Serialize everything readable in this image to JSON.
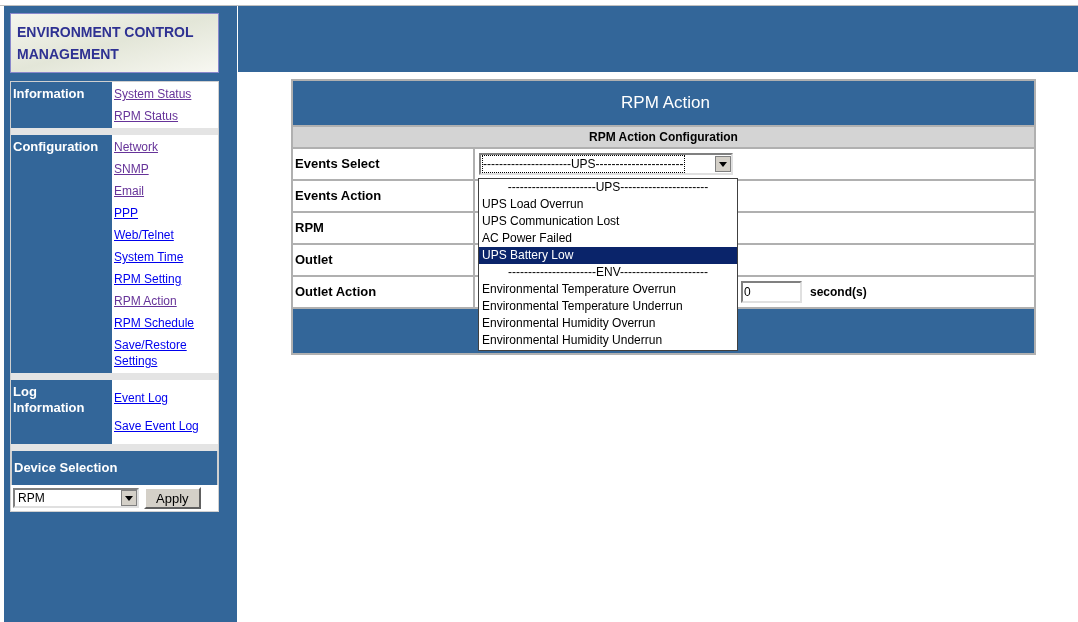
{
  "logo": {
    "title": "ENVIRONMENT CONTROL MANAGEMENT"
  },
  "sidebar": {
    "sections": [
      {
        "label": "Information",
        "links": [
          {
            "text": "System Status",
            "visited": true
          },
          {
            "text": "RPM Status",
            "visited": true
          }
        ]
      },
      {
        "label": "Configuration",
        "links": [
          {
            "text": "Network",
            "visited": true
          },
          {
            "text": "SNMP",
            "visited": true
          },
          {
            "text": "Email",
            "visited": true
          },
          {
            "text": "PPP",
            "visited": false
          },
          {
            "text": "Web/Telnet",
            "visited": false
          },
          {
            "text": "System Time",
            "visited": false
          },
          {
            "text": "RPM Setting",
            "visited": false
          },
          {
            "text": "RPM Action",
            "visited": true
          },
          {
            "text": "RPM Schedule",
            "visited": false
          },
          {
            "text": "Save/Restore Settings",
            "visited": false
          }
        ]
      },
      {
        "label": "Log Information",
        "links": [
          {
            "text": "Event Log",
            "visited": false
          },
          {
            "text": "Save Event Log",
            "visited": false
          }
        ]
      }
    ],
    "device_selection": {
      "title": "Device Selection",
      "value": "RPM",
      "button": "Apply"
    }
  },
  "panel": {
    "title": "RPM Action",
    "subtitle": "RPM Action Configuration",
    "rows": [
      {
        "label": "Events Select",
        "kind": "select",
        "value": "----------------------UPS----------------------"
      },
      {
        "label": "Events Action",
        "kind": "empty"
      },
      {
        "label": "RPM",
        "kind": "empty"
      },
      {
        "label": "Outlet",
        "kind": "empty"
      },
      {
        "label": "Outlet Action",
        "kind": "seconds",
        "value": "0",
        "unit": "second(s)"
      }
    ],
    "dropdown": [
      {
        "text": "----------------------UPS----------------------",
        "selected": false,
        "kind": "header"
      },
      {
        "text": "UPS Load Overrun",
        "selected": false,
        "kind": "option"
      },
      {
        "text": "UPS Communication Lost",
        "selected": false,
        "kind": "option"
      },
      {
        "text": "AC Power Failed",
        "selected": false,
        "kind": "option"
      },
      {
        "text": "UPS Battery Low",
        "selected": true,
        "kind": "option"
      },
      {
        "text": "----------------------ENV----------------------",
        "selected": false,
        "kind": "header"
      },
      {
        "text": "Environmental Temperature Overrun",
        "selected": false,
        "kind": "option"
      },
      {
        "text": "Environmental Temperature Underrun",
        "selected": false,
        "kind": "option"
      },
      {
        "text": "Environmental Humidity Overrun",
        "selected": false,
        "kind": "option"
      },
      {
        "text": "Environmental Humidity Underrun",
        "selected": false,
        "kind": "option"
      }
    ]
  }
}
